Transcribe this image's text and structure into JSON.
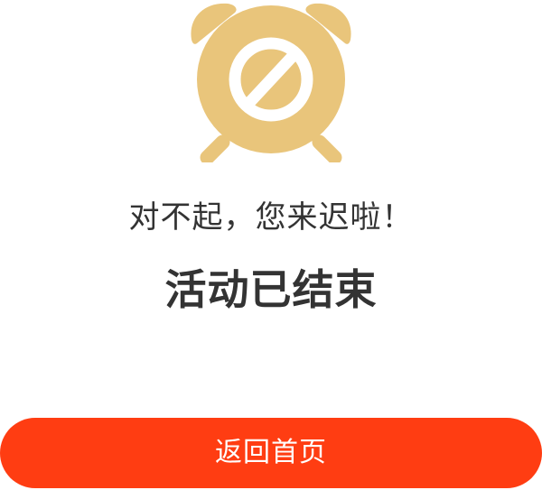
{
  "status_icon": {
    "name": "alarm-clock-forbidden-icon",
    "color": "#E9C57B"
  },
  "message": {
    "apology": "对不起，您来迟啦！",
    "headline": "活动已结束"
  },
  "actions": {
    "home_button_label": "返回首页",
    "accent_color": "#FF3D12"
  }
}
